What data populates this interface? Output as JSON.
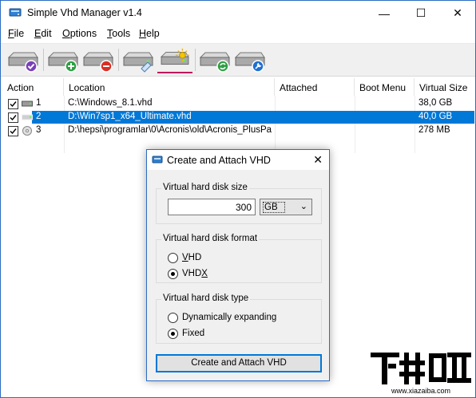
{
  "window": {
    "title": "Simple Vhd Manager v1.4",
    "controls": {
      "minimize": "—",
      "maximize": "☐",
      "close": "✕"
    }
  },
  "menu": [
    "File",
    "Edit",
    "Options",
    "Tools",
    "Help"
  ],
  "menu_mnemonics": [
    "F",
    "E",
    "O",
    "T",
    "H"
  ],
  "toolbar": {
    "buttons": [
      {
        "icon": "drive-check-icon"
      },
      {
        "icon": "drive-add-icon"
      },
      {
        "icon": "drive-remove-icon"
      },
      {
        "icon": "drive-eject-icon"
      },
      {
        "icon": "drive-create-icon",
        "active": true
      },
      {
        "icon": "drive-refresh-icon"
      },
      {
        "icon": "drive-settings-icon"
      }
    ],
    "accent": "#c2185b"
  },
  "list": {
    "columns": [
      "Action",
      "Location",
      "Attached",
      "Boot Menu",
      "Virtual Size"
    ],
    "rows": [
      {
        "checked": true,
        "index": "1",
        "location": "C:\\Windows_8.1.vhd",
        "attached": "",
        "boot_menu": "",
        "size": "38,0 GB",
        "selected": false,
        "drive": "hdd"
      },
      {
        "checked": true,
        "index": "2",
        "location": "D:\\Win7sp1_x64_Ultimate.vhd",
        "attached": "",
        "boot_menu": "",
        "size": "40,0 GB",
        "selected": true,
        "drive": "hdd"
      },
      {
        "checked": true,
        "index": "3",
        "location": "D:\\hepsi\\programlar\\0\\Acronis\\old\\Acronis_PlusPa...",
        "attached": "",
        "boot_menu": "",
        "size": "278 MB",
        "selected": false,
        "drive": "cd"
      }
    ],
    "selection_color": "#0078d7"
  },
  "dialog": {
    "title": "Create and Attach VHD",
    "close": "✕",
    "size_group": {
      "label": "Virtual hard disk size",
      "value": "300",
      "unit": "GB"
    },
    "format_group": {
      "label": "Virtual hard disk format",
      "options": [
        {
          "label": "VHD",
          "mnemonic": "V",
          "checked": false
        },
        {
          "label": "VHDX",
          "mnemonic": "X",
          "checked": true
        }
      ]
    },
    "type_group": {
      "label": "Virtual hard disk type",
      "options": [
        {
          "label": "Dynamically expanding",
          "checked": false
        },
        {
          "label": "Fixed",
          "checked": true
        }
      ]
    },
    "submit_label": "Create and Attach VHD"
  },
  "watermark": {
    "text": "下载吧",
    "url_text": "www.xiazaiba.com"
  }
}
